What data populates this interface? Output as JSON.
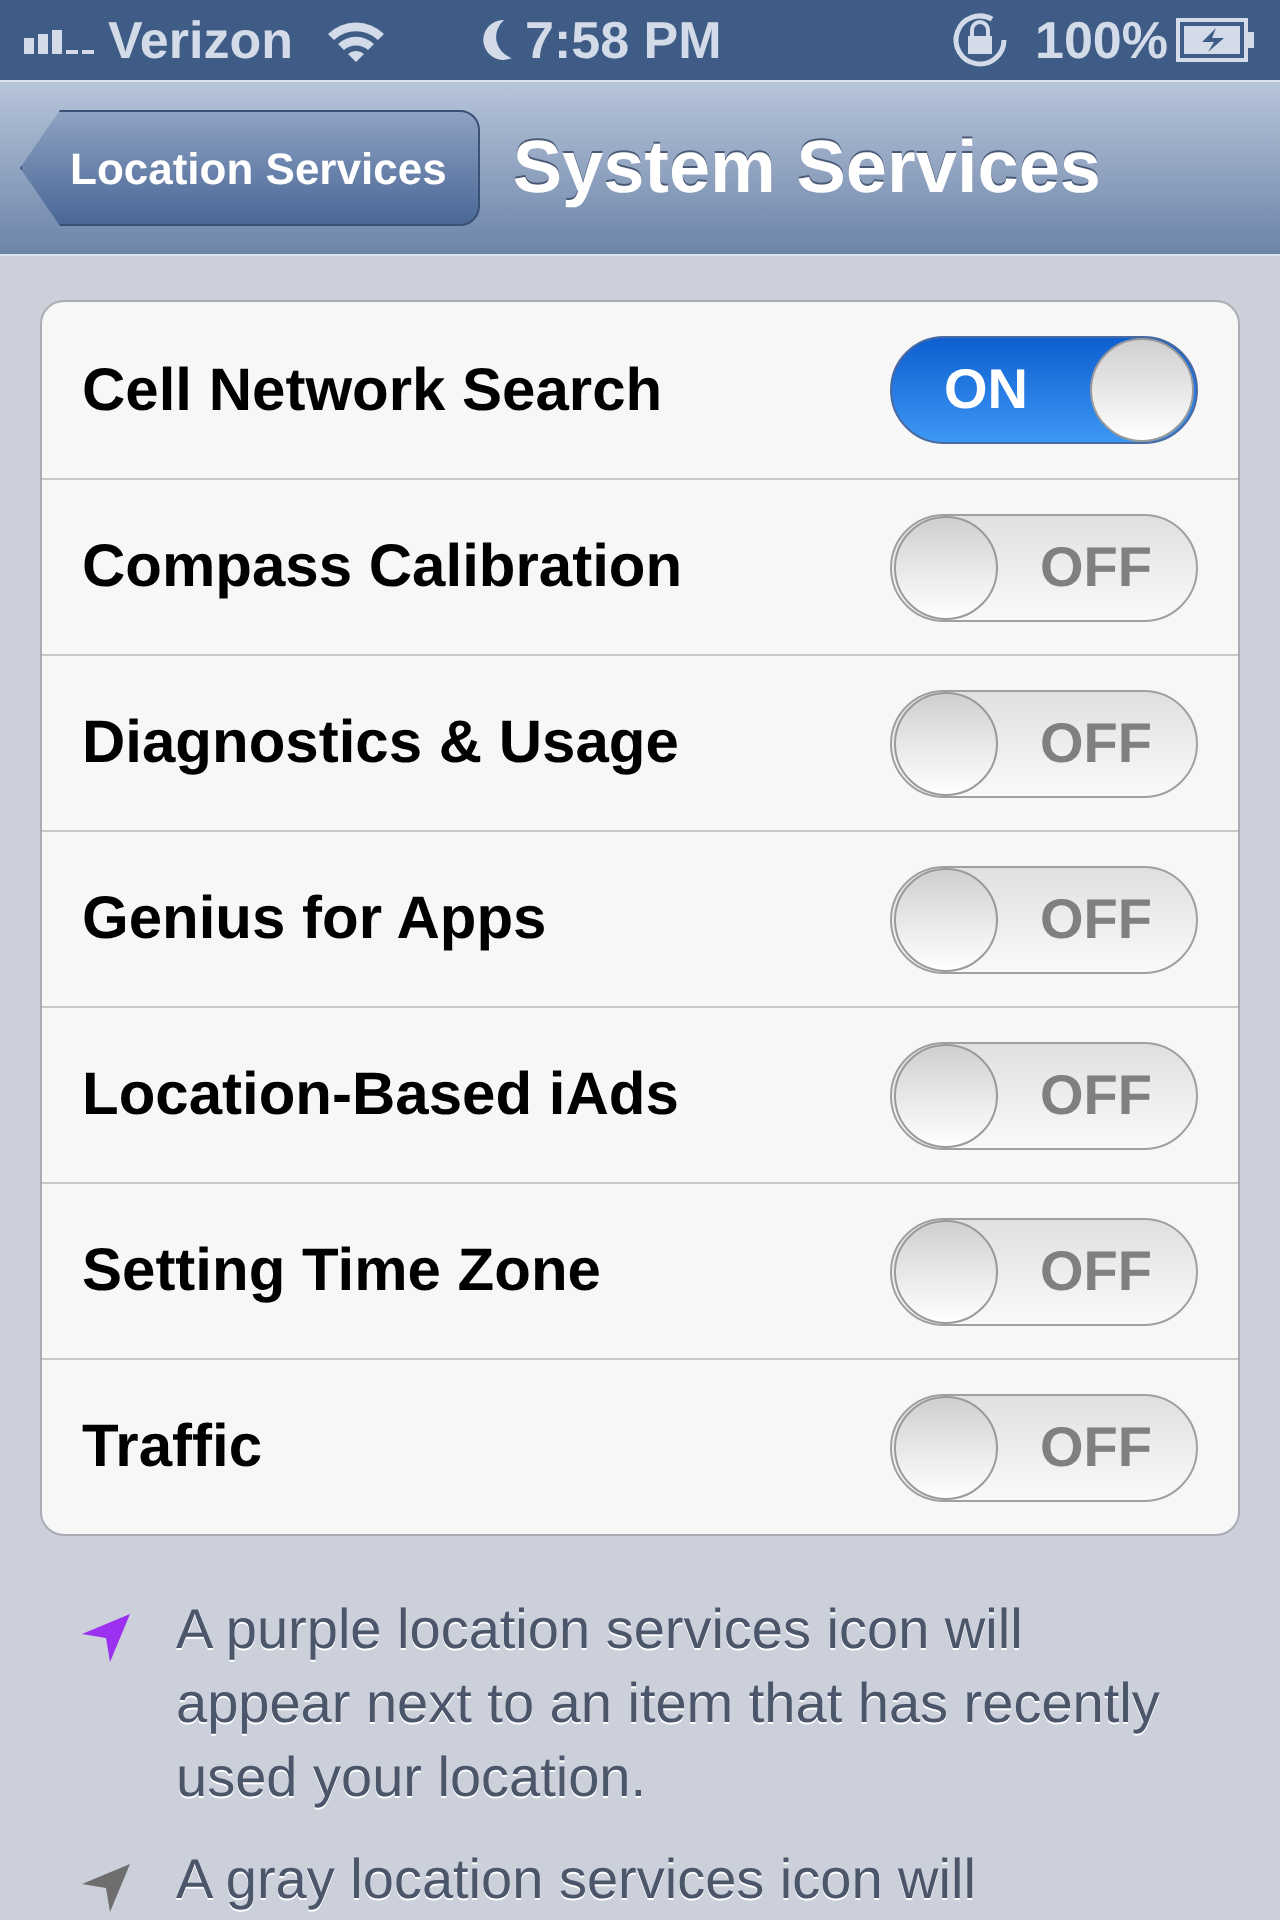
{
  "status_bar": {
    "carrier": "Verizon",
    "time": "7:58 PM",
    "battery": "100%"
  },
  "nav": {
    "back": "Location Services",
    "title": "System Services"
  },
  "settings": [
    {
      "label": "Cell Network Search",
      "on": true,
      "on_text": "ON"
    },
    {
      "label": "Compass Calibration",
      "on": false,
      "off_text": "OFF"
    },
    {
      "label": "Diagnostics & Usage",
      "on": false,
      "off_text": "OFF"
    },
    {
      "label": "Genius for Apps",
      "on": false,
      "off_text": "OFF"
    },
    {
      "label": "Location-Based iAds",
      "on": false,
      "off_text": "OFF"
    },
    {
      "label": "Setting Time Zone",
      "on": false,
      "off_text": "OFF"
    },
    {
      "label": "Traffic",
      "on": false,
      "off_text": "OFF"
    }
  ],
  "notes": [
    {
      "text": "A purple location services icon will appear next to an item that has recently used your location.",
      "color": "#9b30f0"
    },
    {
      "text": "A gray location services icon will",
      "color": "#6e6e6e"
    }
  ]
}
